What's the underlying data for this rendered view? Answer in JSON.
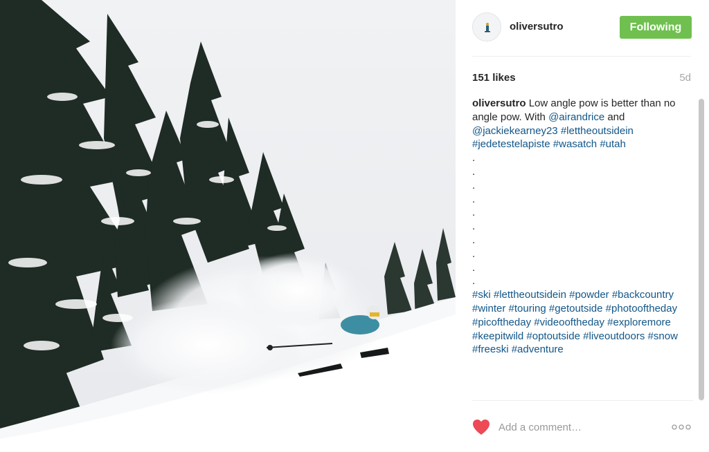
{
  "post": {
    "image_alt": "Skier in deep powder among snowy pine trees"
  },
  "header": {
    "username": "oliversutro",
    "follow_label": "Following"
  },
  "stats": {
    "likes": "151 likes",
    "age": "5d"
  },
  "caption": {
    "author": "oliversutro",
    "text_1": " Low angle pow is better than no angle pow. With ",
    "mention_1": "@airandrice",
    "text_2": " and ",
    "mention_2": "@jackiekearney23",
    "tags_line_1": [
      "#lettheoutsidein",
      "#jedetestelapiste",
      "#wasatch",
      "#utah"
    ],
    "dot": ".",
    "tags_line_2": [
      "#ski",
      "#lettheoutsidein",
      "#powder",
      "#backcountry",
      "#winter",
      "#touring",
      "#getoutside",
      "#photooftheday",
      "#picoftheday",
      "#videooftheday",
      "#exploremore",
      "#keepitwild",
      "#optoutside",
      "#liveoutdoors",
      "#snow",
      "#freeski",
      "#adventure"
    ]
  },
  "comment": {
    "placeholder": "Add a comment…"
  },
  "colors": {
    "follow": "#70c050",
    "link": "#125688",
    "heart": "#ed4956"
  },
  "icons": {
    "like": "heart-icon",
    "more": "more-options-icon"
  }
}
